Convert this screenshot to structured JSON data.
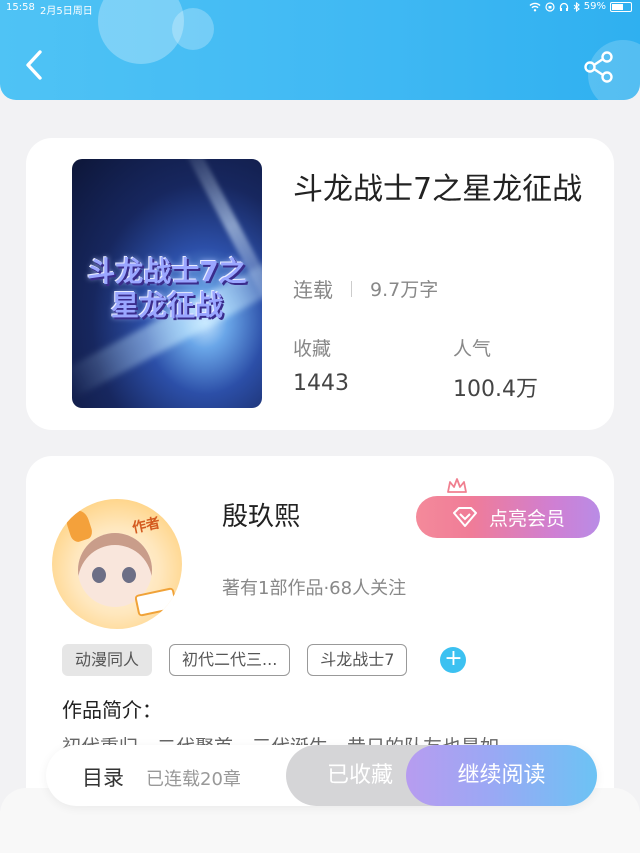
{
  "status_bar": {
    "time": "15:58",
    "date": "2月5日周日",
    "battery": "59%"
  },
  "header": {
    "back_icon": "chevron-left-icon",
    "share_icon": "share-icon",
    "accent": "#3fb8f3"
  },
  "book": {
    "cover_title": "斗龙战士7之星龙征战",
    "title": "斗龙战士7之星龙征战",
    "status": "连载",
    "word_count": "9.7万字",
    "favorites_label": "收藏",
    "favorites_value": "1443",
    "popularity_label": "人气",
    "popularity_value": "100.4万"
  },
  "author": {
    "name": "殷玖熙",
    "avatar_tag": "作者",
    "info": "著有1部作品·68人关注",
    "vip_button": "点亮会员",
    "tags": [
      "动漫同人",
      "初代二代三...",
      "斗龙战士7"
    ],
    "add_tag_icon": "plus-icon",
    "intro_title": "作品简介：",
    "intro_text": "初代重归，二代聚首，三代诞生，昔日的队友也是如"
  },
  "bottom_bar": {
    "toc_label": "目录",
    "toc_count": "已连载20章",
    "collected_button": "已收藏",
    "read_button": "继续阅读"
  }
}
